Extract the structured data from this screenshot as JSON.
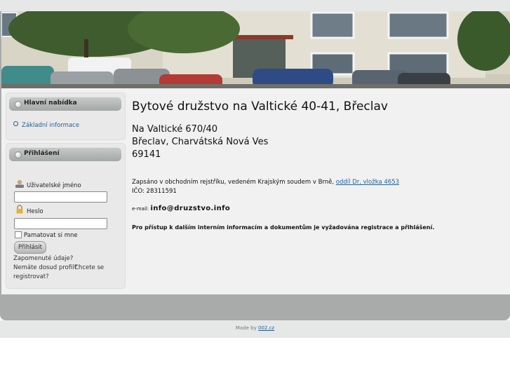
{
  "sidebar": {
    "main_menu": {
      "title": "Hlavní nabídka",
      "items": [
        {
          "label": "Základní informace"
        }
      ]
    },
    "login": {
      "title": "Přihlášení",
      "username_label": "Uživatelské jméno",
      "password_label": "Heslo",
      "remember_label": "Pamatovat si mne",
      "submit_label": "Přihlásit",
      "forgot_link": "Zapomenuté údaje?",
      "no_profile_text": "Nemáte dosud profil?",
      "register_link_part1": "Chcete se",
      "register_link_part2": "registrovat?"
    }
  },
  "main": {
    "title": "Bytové družstvo na Valtické 40-41, Břeclav",
    "address": [
      "Na Valtické 670/40",
      "Břeclav, Charvátská Nová Ves",
      "69141"
    ],
    "registration_text": "Zapsáno v obchodním rejstříku, vedeném Krajským soudem v Brně,",
    "registration_link": "oddíl Dr, vložka 4653",
    "ico": "IČO: 28311591",
    "email_label": "e-mail:",
    "email_value": "info@druzstvo.info",
    "notice": "Pro přístup k dalším interním informacím a dokumentům je vyžadována registrace a přihlášení."
  },
  "footer": {
    "made_by": "Made by",
    "made_by_link": "002.cz"
  },
  "icons": {
    "user": "user-icon",
    "lock": "lock-icon",
    "bullet": "bullet-icon"
  }
}
